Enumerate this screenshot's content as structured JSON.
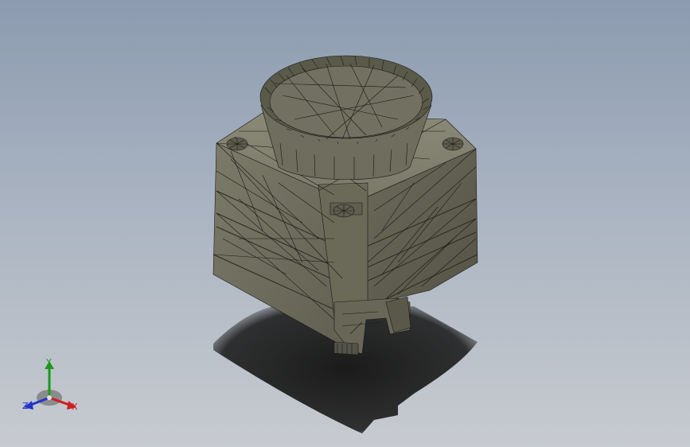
{
  "triad": {
    "x_label": "X",
    "y_label": "Y",
    "z_label": "Z",
    "x_color": "#cc1f1f",
    "y_color": "#1a9a1a",
    "z_color": "#2233cc"
  },
  "colors": {
    "background_top": "#8c9bb0",
    "background_bottom": "#c7cbd0",
    "model_face": "#747262",
    "mesh_line": "#1a1a14",
    "shadow": "#1b1b1b"
  },
  "model_icon": "meshed-3d-part"
}
